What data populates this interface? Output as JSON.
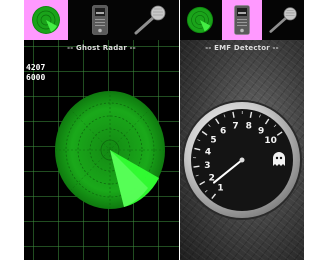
{
  "tabs": [
    {
      "icon": "radar-icon",
      "active": true
    },
    {
      "icon": "emf-meter-icon",
      "active": false
    },
    {
      "icon": "microphone-icon",
      "active": false
    }
  ],
  "ghost_radar": {
    "title": "-- Ghost Radar --",
    "readout_line1": "4207",
    "readout_line2": "6000"
  },
  "emf_detector": {
    "title": "-- EMF Detector --",
    "dial_labels": [
      "1",
      "2",
      "3",
      "4",
      "5",
      "6",
      "7",
      "8",
      "9",
      "10"
    ],
    "needle_value": 1.6,
    "ghost_icon": "ghost-icon"
  },
  "colors": {
    "active_tab": "#ff99ff",
    "radar_green": "#22dd22",
    "grid_green": "#3c8c3c"
  }
}
